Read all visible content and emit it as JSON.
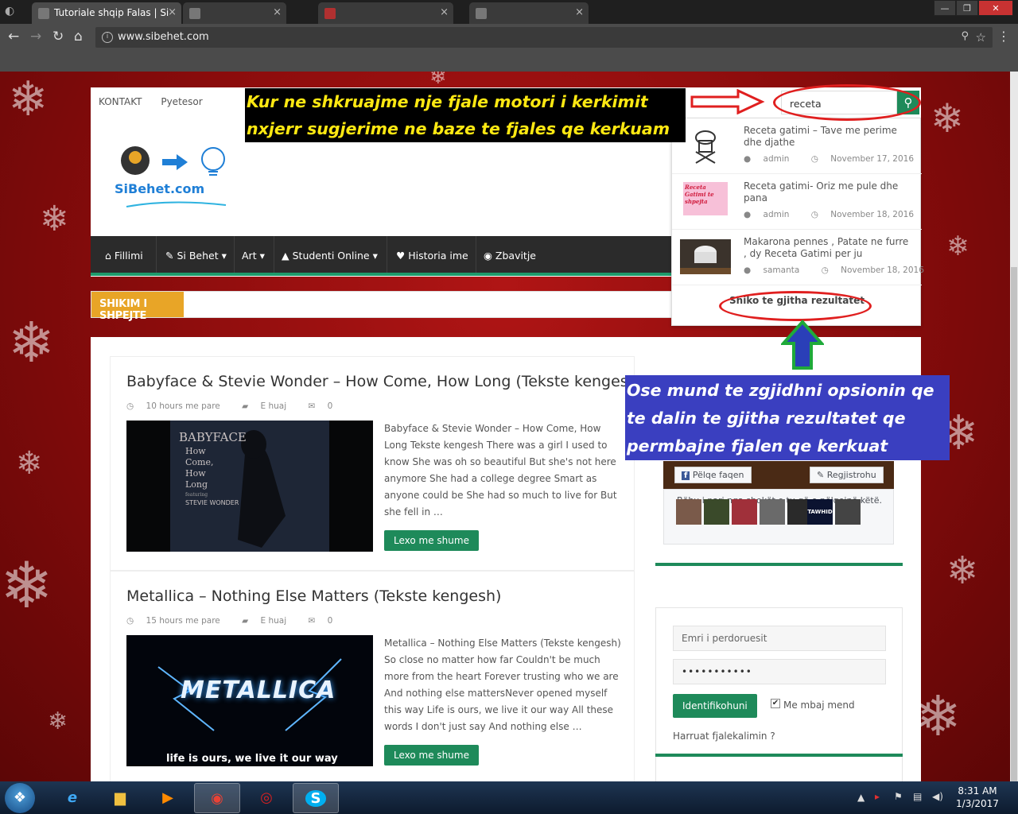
{
  "browser": {
    "tabs": [
      {
        "title": "Tutoriale shqip Falas | Si",
        "active": true
      },
      {
        "title": "",
        "active": false
      },
      {
        "title": "",
        "active": false
      },
      {
        "title": "",
        "active": false
      }
    ],
    "url": "www.sibehet.com"
  },
  "site": {
    "top_links": [
      "KONTAKT",
      "Pyetesor"
    ],
    "logo_text": "SiBehet.com",
    "nav": [
      {
        "icon": "home-icon",
        "label": "Fillimi",
        "dropdown": false
      },
      {
        "icon": "wrench-icon",
        "label": "Si Behet",
        "dropdown": true
      },
      {
        "icon": "",
        "label": "Art",
        "dropdown": true
      },
      {
        "icon": "graduation-cap-icon",
        "label": "Studenti Online",
        "dropdown": true
      },
      {
        "icon": "heartbeat-icon",
        "label": "Historia ime",
        "dropdown": false
      },
      {
        "icon": "gamepad-icon",
        "label": "Zbavitje",
        "dropdown": false
      }
    ],
    "ticker_label": "SHIKIM I SHPEJTE"
  },
  "search": {
    "value": "receta",
    "results": [
      {
        "title": "Receta gatimi – Tave me perime dhe djathe",
        "author": "admin",
        "date": "November 17, 2016"
      },
      {
        "title": "Receta gatimi- Oriz me pule dhe pana",
        "author": "admin",
        "date": "November 18, 2016",
        "thumb_text": "Receta Gatimi te shpejta"
      },
      {
        "title": "Makarona pennes , Patate ne furre , dy Receta Gatimi per ju",
        "author": "samanta",
        "date": "November 18, 2016"
      }
    ],
    "see_all_label": "Shiko te gjitha rezultatet"
  },
  "posts": [
    {
      "title": "Babyface & Stevie Wonder – How Come, How Long (Tekste kengesh)",
      "time": "10 hours me pare",
      "category": "E huaj",
      "comments": "0",
      "excerpt": "Babyface & Stevie Wonder – How Come, How Long Tekste kengesh   There was a girl I used to know She was oh so beautiful But she's not here anymore She had a college degree Smart as anyone could be She had so much to live for But she fell in …",
      "read_more": "Lexo me shume",
      "thumb_text": {
        "title": "BABYFACE",
        "lines": [
          "How",
          "Come,",
          "How",
          "Long"
        ],
        "featuring": "featuring",
        "artist": "STEVIE WONDER"
      }
    },
    {
      "title": "Metallica – Nothing Else Matters (Tekste kengesh)",
      "time": "15 hours me pare",
      "category": "E huaj",
      "comments": "0",
      "excerpt": "Metallica – Nothing Else Matters (Tekste kengesh) So close no matter how far Couldn't be much more from the heart Forever trusting who we are And nothing else mattersNever opened myself this way Life is ours, we live it our way All these words I don't just say And nothing else …",
      "read_more": "Lexo me shume",
      "thumb_text": {
        "logo": "METALLICA",
        "caption": "life is ours, we live it our way"
      }
    }
  ],
  "sidebar": {
    "fb_like": "Pëlqe faqen",
    "fb_register": "Regjistrohu",
    "fb_text": "Bëhu i pari nga shokët e tu që e pëlqejnë këtë.",
    "fb_avatar_label": "TAWHID",
    "login": {
      "username_placeholder": "Emri i perdoruesit",
      "password_value": "•••••••••••",
      "submit_label": "Identifikohuni",
      "remember_label": "Me mbaj mend",
      "forgot_label": "Harruat fjalekalimin ?"
    }
  },
  "annotations": {
    "top": [
      "Kur ne shkruajme nje fjale motori i kerkimit",
      "nxjerr sugjerime ne baze te fjales qe kerkuam"
    ],
    "bottom": [
      "Ose mund te zgjidhni opsionin qe",
      "te dalin te gjitha rezultatet qe",
      "permbajne fjalen qe kerkuat"
    ]
  },
  "taskbar": {
    "time": "8:31 AM",
    "date": "1/3/2017"
  },
  "colors": {
    "accent_green": "#1e8a5a",
    "nav_dark": "#2b2b2b",
    "ticker_orange": "#e8a527",
    "annotation_yellow": "#ffe812",
    "annotation_blue": "#3a3fc0",
    "annotation_red": "#e01f1f"
  }
}
